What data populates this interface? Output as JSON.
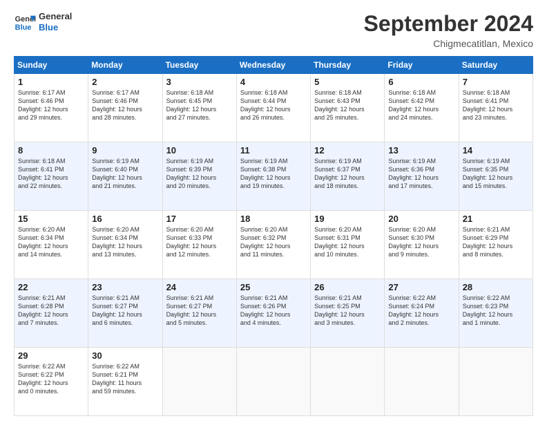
{
  "logo": {
    "line1": "General",
    "line2": "Blue"
  },
  "title": "September 2024",
  "location": "Chigmecatitlan, Mexico",
  "days_of_week": [
    "Sunday",
    "Monday",
    "Tuesday",
    "Wednesday",
    "Thursday",
    "Friday",
    "Saturday"
  ],
  "weeks": [
    [
      {
        "day": "1",
        "lines": [
          "Sunrise: 6:17 AM",
          "Sunset: 6:46 PM",
          "Daylight: 12 hours",
          "and 29 minutes."
        ]
      },
      {
        "day": "2",
        "lines": [
          "Sunrise: 6:17 AM",
          "Sunset: 6:46 PM",
          "Daylight: 12 hours",
          "and 28 minutes."
        ]
      },
      {
        "day": "3",
        "lines": [
          "Sunrise: 6:18 AM",
          "Sunset: 6:45 PM",
          "Daylight: 12 hours",
          "and 27 minutes."
        ]
      },
      {
        "day": "4",
        "lines": [
          "Sunrise: 6:18 AM",
          "Sunset: 6:44 PM",
          "Daylight: 12 hours",
          "and 26 minutes."
        ]
      },
      {
        "day": "5",
        "lines": [
          "Sunrise: 6:18 AM",
          "Sunset: 6:43 PM",
          "Daylight: 12 hours",
          "and 25 minutes."
        ]
      },
      {
        "day": "6",
        "lines": [
          "Sunrise: 6:18 AM",
          "Sunset: 6:42 PM",
          "Daylight: 12 hours",
          "and 24 minutes."
        ]
      },
      {
        "day": "7",
        "lines": [
          "Sunrise: 6:18 AM",
          "Sunset: 6:41 PM",
          "Daylight: 12 hours",
          "and 23 minutes."
        ]
      }
    ],
    [
      {
        "day": "8",
        "lines": [
          "Sunrise: 6:18 AM",
          "Sunset: 6:41 PM",
          "Daylight: 12 hours",
          "and 22 minutes."
        ]
      },
      {
        "day": "9",
        "lines": [
          "Sunrise: 6:19 AM",
          "Sunset: 6:40 PM",
          "Daylight: 12 hours",
          "and 21 minutes."
        ]
      },
      {
        "day": "10",
        "lines": [
          "Sunrise: 6:19 AM",
          "Sunset: 6:39 PM",
          "Daylight: 12 hours",
          "and 20 minutes."
        ]
      },
      {
        "day": "11",
        "lines": [
          "Sunrise: 6:19 AM",
          "Sunset: 6:38 PM",
          "Daylight: 12 hours",
          "and 19 minutes."
        ]
      },
      {
        "day": "12",
        "lines": [
          "Sunrise: 6:19 AM",
          "Sunset: 6:37 PM",
          "Daylight: 12 hours",
          "and 18 minutes."
        ]
      },
      {
        "day": "13",
        "lines": [
          "Sunrise: 6:19 AM",
          "Sunset: 6:36 PM",
          "Daylight: 12 hours",
          "and 17 minutes."
        ]
      },
      {
        "day": "14",
        "lines": [
          "Sunrise: 6:19 AM",
          "Sunset: 6:35 PM",
          "Daylight: 12 hours",
          "and 15 minutes."
        ]
      }
    ],
    [
      {
        "day": "15",
        "lines": [
          "Sunrise: 6:20 AM",
          "Sunset: 6:34 PM",
          "Daylight: 12 hours",
          "and 14 minutes."
        ]
      },
      {
        "day": "16",
        "lines": [
          "Sunrise: 6:20 AM",
          "Sunset: 6:34 PM",
          "Daylight: 12 hours",
          "and 13 minutes."
        ]
      },
      {
        "day": "17",
        "lines": [
          "Sunrise: 6:20 AM",
          "Sunset: 6:33 PM",
          "Daylight: 12 hours",
          "and 12 minutes."
        ]
      },
      {
        "day": "18",
        "lines": [
          "Sunrise: 6:20 AM",
          "Sunset: 6:32 PM",
          "Daylight: 12 hours",
          "and 11 minutes."
        ]
      },
      {
        "day": "19",
        "lines": [
          "Sunrise: 6:20 AM",
          "Sunset: 6:31 PM",
          "Daylight: 12 hours",
          "and 10 minutes."
        ]
      },
      {
        "day": "20",
        "lines": [
          "Sunrise: 6:20 AM",
          "Sunset: 6:30 PM",
          "Daylight: 12 hours",
          "and 9 minutes."
        ]
      },
      {
        "day": "21",
        "lines": [
          "Sunrise: 6:21 AM",
          "Sunset: 6:29 PM",
          "Daylight: 12 hours",
          "and 8 minutes."
        ]
      }
    ],
    [
      {
        "day": "22",
        "lines": [
          "Sunrise: 6:21 AM",
          "Sunset: 6:28 PM",
          "Daylight: 12 hours",
          "and 7 minutes."
        ]
      },
      {
        "day": "23",
        "lines": [
          "Sunrise: 6:21 AM",
          "Sunset: 6:27 PM",
          "Daylight: 12 hours",
          "and 6 minutes."
        ]
      },
      {
        "day": "24",
        "lines": [
          "Sunrise: 6:21 AM",
          "Sunset: 6:27 PM",
          "Daylight: 12 hours",
          "and 5 minutes."
        ]
      },
      {
        "day": "25",
        "lines": [
          "Sunrise: 6:21 AM",
          "Sunset: 6:26 PM",
          "Daylight: 12 hours",
          "and 4 minutes."
        ]
      },
      {
        "day": "26",
        "lines": [
          "Sunrise: 6:21 AM",
          "Sunset: 6:25 PM",
          "Daylight: 12 hours",
          "and 3 minutes."
        ]
      },
      {
        "day": "27",
        "lines": [
          "Sunrise: 6:22 AM",
          "Sunset: 6:24 PM",
          "Daylight: 12 hours",
          "and 2 minutes."
        ]
      },
      {
        "day": "28",
        "lines": [
          "Sunrise: 6:22 AM",
          "Sunset: 6:23 PM",
          "Daylight: 12 hours",
          "and 1 minute."
        ]
      }
    ],
    [
      {
        "day": "29",
        "lines": [
          "Sunrise: 6:22 AM",
          "Sunset: 6:22 PM",
          "Daylight: 12 hours",
          "and 0 minutes."
        ]
      },
      {
        "day": "30",
        "lines": [
          "Sunrise: 6:22 AM",
          "Sunset: 6:21 PM",
          "Daylight: 11 hours",
          "and 59 minutes."
        ]
      },
      null,
      null,
      null,
      null,
      null
    ]
  ]
}
